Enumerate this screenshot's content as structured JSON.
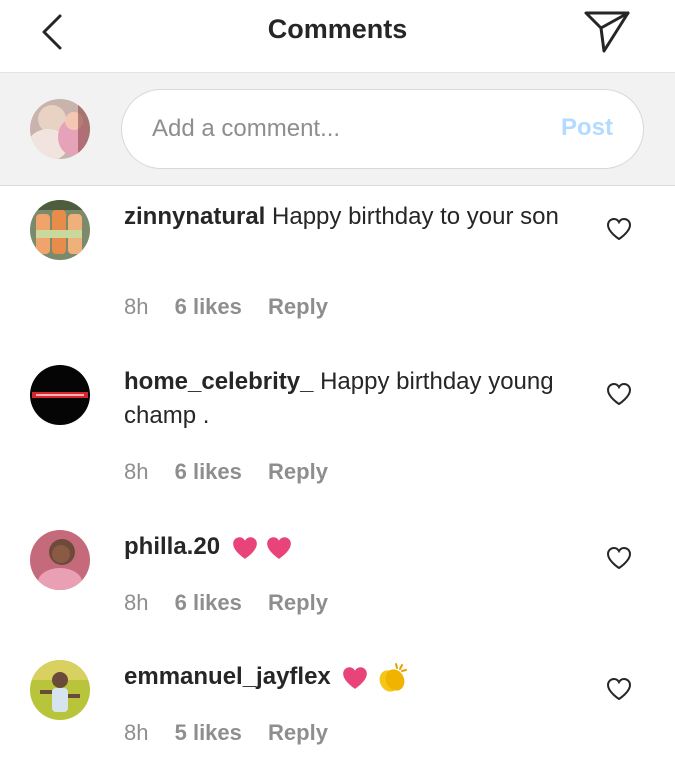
{
  "header": {
    "title": "Comments",
    "back_icon": "chevron-left-icon",
    "send_icon": "paper-plane-icon"
  },
  "composer": {
    "placeholder": "Add a comment...",
    "post_label": "Post",
    "post_color": "#b3dbff"
  },
  "comments": [
    {
      "username": "zinnynatural",
      "text": "Happy birthday to your son",
      "time": "8h",
      "likes": "6 likes",
      "reply": "Reply"
    },
    {
      "username": "home_celebrity_",
      "text": "Happy birthday young champ .",
      "time": "8h",
      "likes": "6 likes",
      "reply": "Reply"
    },
    {
      "username": "philla.20",
      "text": "",
      "emojis": [
        "heart-emoji",
        "heart-emoji"
      ],
      "time": "8h",
      "likes": "6 likes",
      "reply": "Reply"
    },
    {
      "username": "emmanuel_jayflex",
      "text": "",
      "emojis": [
        "heart-emoji",
        "clapping-hands-emoji"
      ],
      "time": "8h",
      "likes": "5 likes",
      "reply": "Reply"
    }
  ],
  "colors": {
    "text": "#262626",
    "muted": "#8e8e8e",
    "heart": "#e8447a",
    "clap": "#f5c518"
  }
}
